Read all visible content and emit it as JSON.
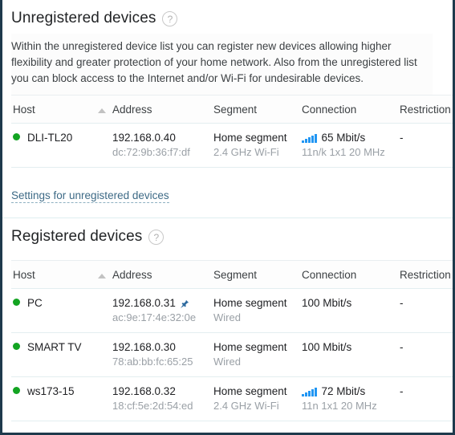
{
  "colors": {
    "frame_border": "#1e3a4c",
    "status_online": "#13a422",
    "signal_bar": "#2196f3",
    "link": "#3d6a86",
    "pin": "#2d6a9f",
    "muted_text": "#9aa0a6"
  },
  "unregistered": {
    "title": "Unregistered devices",
    "help_icon": "question-mark-circle-icon",
    "description": "Within the unregistered device list you can register new devices allowing higher flexibility and greater protection of your home network. Also from the unregistered list you can block access to the Internet and/or Wi-Fi for undesirable devices.",
    "columns": [
      "Host",
      "Address",
      "Segment",
      "Connection",
      "Restriction"
    ],
    "sort_column": "Host",
    "sort_direction": "ascending",
    "rows": [
      {
        "status": "online",
        "host": "DLI-TL20",
        "ip": "192.168.0.40",
        "mac": "dc:72:9b:36:f7:df",
        "pinned": false,
        "segment": "Home segment",
        "segment_sub": "2.4 GHz Wi-Fi",
        "has_signal": true,
        "speed": "65 Mbit/s",
        "conn_sub": "11n/k 1x1 20 MHz",
        "restriction": "-"
      }
    ],
    "settings_link": "Settings for unregistered devices"
  },
  "registered": {
    "title": "Registered devices",
    "help_icon": "question-mark-circle-icon",
    "columns": [
      "Host",
      "Address",
      "Segment",
      "Connection",
      "Restriction"
    ],
    "sort_column": "Host",
    "sort_direction": "ascending",
    "rows": [
      {
        "status": "online",
        "host": "PC",
        "ip": "192.168.0.31",
        "mac": "ac:9e:17:4e:32:0e",
        "pinned": true,
        "segment": "Home segment",
        "segment_sub": "Wired",
        "has_signal": false,
        "speed": "100 Mbit/s",
        "conn_sub": "",
        "restriction": "-"
      },
      {
        "status": "online",
        "host": "SMART TV",
        "ip": "192.168.0.30",
        "mac": "78:ab:bb:fc:65:25",
        "pinned": false,
        "segment": "Home segment",
        "segment_sub": "Wired",
        "has_signal": false,
        "speed": "100 Mbit/s",
        "conn_sub": "",
        "restriction": "-"
      },
      {
        "status": "online",
        "host": "ws173-15",
        "ip": "192.168.0.32",
        "mac": "18:cf:5e:2d:54:ed",
        "pinned": false,
        "segment": "Home segment",
        "segment_sub": "2.4 GHz Wi-Fi",
        "has_signal": true,
        "speed": "72 Mbit/s",
        "conn_sub": "11n 1x1 20 MHz",
        "restriction": "-"
      }
    ]
  }
}
